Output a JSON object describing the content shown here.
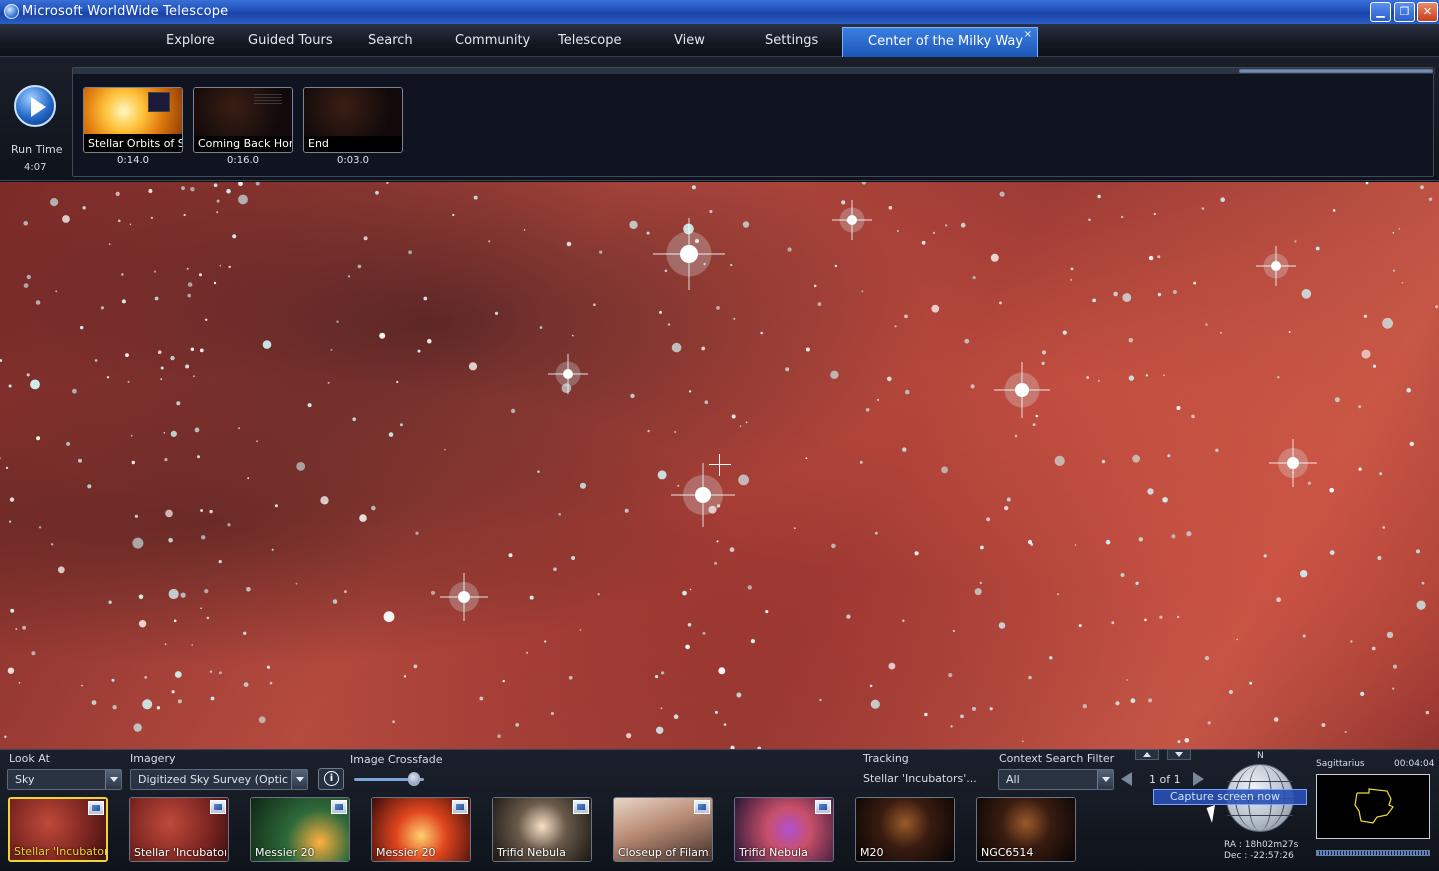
{
  "window": {
    "title": "Microsoft WorldWide Telescope"
  },
  "menu": {
    "explore": "Explore",
    "guided_tours": "Guided Tours",
    "search": "Search",
    "community": "Community",
    "telescope": "Telescope",
    "view": "View",
    "settings": "Settings",
    "active_tab": "Center of the Milky Way",
    "tab_close": "×"
  },
  "tour": {
    "run_time_label": "Run Time",
    "run_time_value": "4:07",
    "slides": [
      {
        "label": "Stellar Orbits of S...",
        "time": "0:14.0"
      },
      {
        "label": "Coming Back Home",
        "time": "0:16.0"
      },
      {
        "label": "End",
        "time": "0:03.0"
      }
    ]
  },
  "controls": {
    "look_at_label": "Look At",
    "look_at_value": "Sky",
    "imagery_label": "Imagery",
    "imagery_value": "Digitized Sky Survey (Optical...",
    "info_symbol": "i",
    "crossfade_label": "Image Crossfade",
    "crossfade_value": 0.85,
    "tracking_label": "Tracking",
    "tracking_value": "Stellar 'Incubators'...",
    "context_filter_label": "Context Search Filter",
    "context_filter_value": "All",
    "pager_text": "1 of 1"
  },
  "thumbnails": [
    {
      "label": "Stellar 'Incubator...",
      "selected": true
    },
    {
      "label": "Stellar 'Incubator..."
    },
    {
      "label": "Messier 20"
    },
    {
      "label": "Messier 20"
    },
    {
      "label": "Trifid Nebula"
    },
    {
      "label": "Closeup of Filam..."
    },
    {
      "label": "Trifid Nebula"
    },
    {
      "label": "M20"
    },
    {
      "label": "NGC6514"
    }
  ],
  "navigator": {
    "north_label": "N",
    "capture_tooltip": "Capture screen now",
    "ra": "RA :  18h02m27s",
    "dec": "Dec :  -22:57:26",
    "constellation": "Sagittarius",
    "time": "00:04:04"
  },
  "colors": {
    "accent": "#2a64c8",
    "selected_border": "#f2d23a",
    "nebula": "#b54a3e"
  }
}
